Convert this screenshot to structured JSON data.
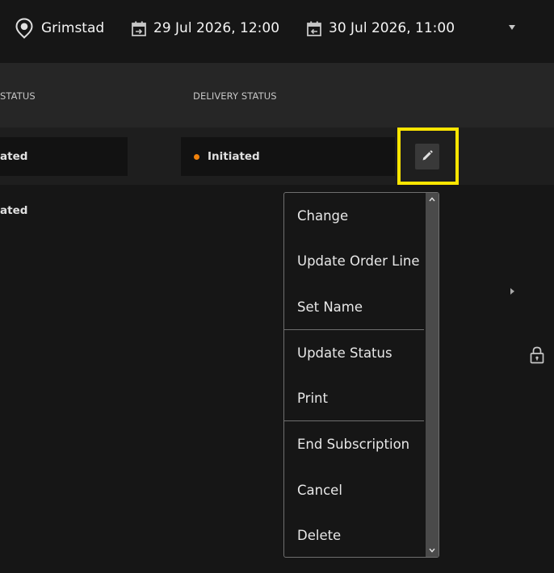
{
  "topbar": {
    "location": "Grimstad",
    "start_date": "29 Jul 2026, 12:00",
    "end_date": "30 Jul 2026, 11:00",
    "icons": {
      "location": "map-pin-icon",
      "start": "calendar-icon",
      "end": "calendar-icon",
      "caret": "caret-down-icon"
    }
  },
  "table": {
    "headers": {
      "status": "STATUS",
      "delivery_status": "DELIVERY STATUS"
    },
    "rows": [
      {
        "status": "ated",
        "delivery_status": "Initiated"
      },
      {
        "status": "ated"
      }
    ]
  },
  "menu": {
    "items": [
      "Change",
      "Update Order Line",
      "Set Name",
      "Update Status",
      "Print",
      "End Subscription",
      "Cancel",
      "Delete"
    ]
  },
  "colors": {
    "background": "#161616",
    "header": "#262626",
    "highlight": "#ffe600",
    "status_dot": "#f1820c"
  }
}
